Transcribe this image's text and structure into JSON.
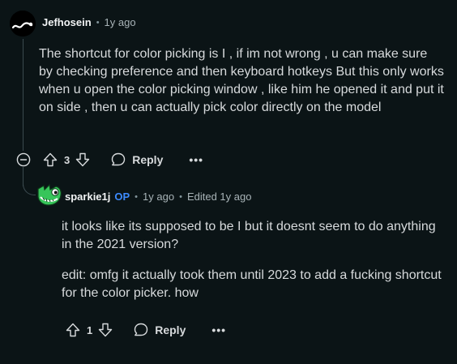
{
  "comments": [
    {
      "author": "Jefhosein",
      "time": "1y ago",
      "body": "The shortcut for color picking is I , if im not wrong , u can make sure by checking preference and then keyboard hotkeys But this only works when u open the color picking window , like him he opened it and put it on side , then u can actually pick color directly on the model",
      "votes": "3",
      "reply_label": "Reply",
      "more_label": "•••"
    },
    {
      "author": "sparkie1j",
      "op_tag": "OP",
      "time": "1y ago",
      "edited": "Edited 1y ago",
      "paragraphs": [
        "it looks like its supposed to be I but it doesnt seem to do anything in the 2021 version?",
        "edit: omfg it actually took them until 2023 to add a fucking shortcut for the color picker. how"
      ],
      "votes": "1",
      "reply_label": "Reply",
      "more_label": "•••"
    }
  ],
  "separator": "•",
  "colors": {
    "background": "#0b1416",
    "text": "#d7dadc",
    "op_accent": "#3d8bff",
    "thread_line": "#3b4a4f",
    "avatar_green": "#37c55a"
  },
  "icons": {
    "collapse": "circle-minus",
    "upvote": "arrow-up-outline",
    "downvote": "arrow-down-outline",
    "reply": "speech-bubble-outline",
    "more": "ellipsis"
  }
}
